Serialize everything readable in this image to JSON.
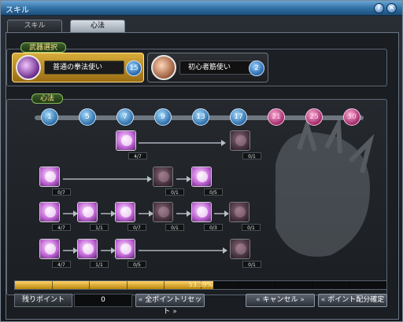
{
  "window": {
    "title": "スキル",
    "help_label": "?",
    "close_label": "×"
  },
  "tabs": [
    {
      "label": "スキル"
    },
    {
      "label": "心法"
    }
  ],
  "weapon_section": {
    "header": "武器選択",
    "weapons": [
      {
        "label": "普通の拳法使い",
        "badge": "15",
        "selected": true,
        "icon": "fist-icon"
      },
      {
        "label": "初心者筋使い",
        "badge": "2",
        "selected": false,
        "icon": "fist-icon"
      }
    ]
  },
  "shinpo_section": {
    "header": "心法",
    "levels": [
      "1",
      "5",
      "7",
      "9",
      "13",
      "17",
      "21",
      "25",
      "30"
    ],
    "unlocked_levels": 6,
    "nodes": [
      {
        "id": "r1a",
        "count": "4/7",
        "active": true
      },
      {
        "id": "r1b",
        "count": "0/1",
        "active": false
      },
      {
        "id": "r2a",
        "count": "0/7",
        "active": true
      },
      {
        "id": "r2b",
        "count": "0/1",
        "active": false
      },
      {
        "id": "r2c",
        "count": "0/5",
        "active": true
      },
      {
        "id": "r3a",
        "count": "4/7",
        "active": true
      },
      {
        "id": "r3b",
        "count": "1/1",
        "active": true
      },
      {
        "id": "r3c",
        "count": "0/7",
        "active": true
      },
      {
        "id": "r3d",
        "count": "0/1",
        "active": false
      },
      {
        "id": "r3e",
        "count": "0/3",
        "active": true
      },
      {
        "id": "r3f",
        "count": "0/1",
        "active": false
      },
      {
        "id": "r4a",
        "count": "4/7",
        "active": true
      },
      {
        "id": "r4b",
        "count": "1/1",
        "active": true
      },
      {
        "id": "r4c",
        "count": "0/5",
        "active": true
      },
      {
        "id": "r4d",
        "count": "0/1",
        "active": false
      }
    ]
  },
  "progress": {
    "text": "53.39%",
    "fraction": 0.5339
  },
  "bottom": {
    "points_label": "残りポイント",
    "points_value": "0",
    "reset_label": "全ポイントリセット",
    "cancel_label": "キャンセル",
    "confirm_label": "ポイント配分確定",
    "chevron_left": "«",
    "chevron_right": "»"
  },
  "colors": {
    "title_bar": "#2f6ea3",
    "accent_gold": "#d8ac3a",
    "level_blue": "#2d6ea8",
    "level_pink": "#a12a6a"
  }
}
